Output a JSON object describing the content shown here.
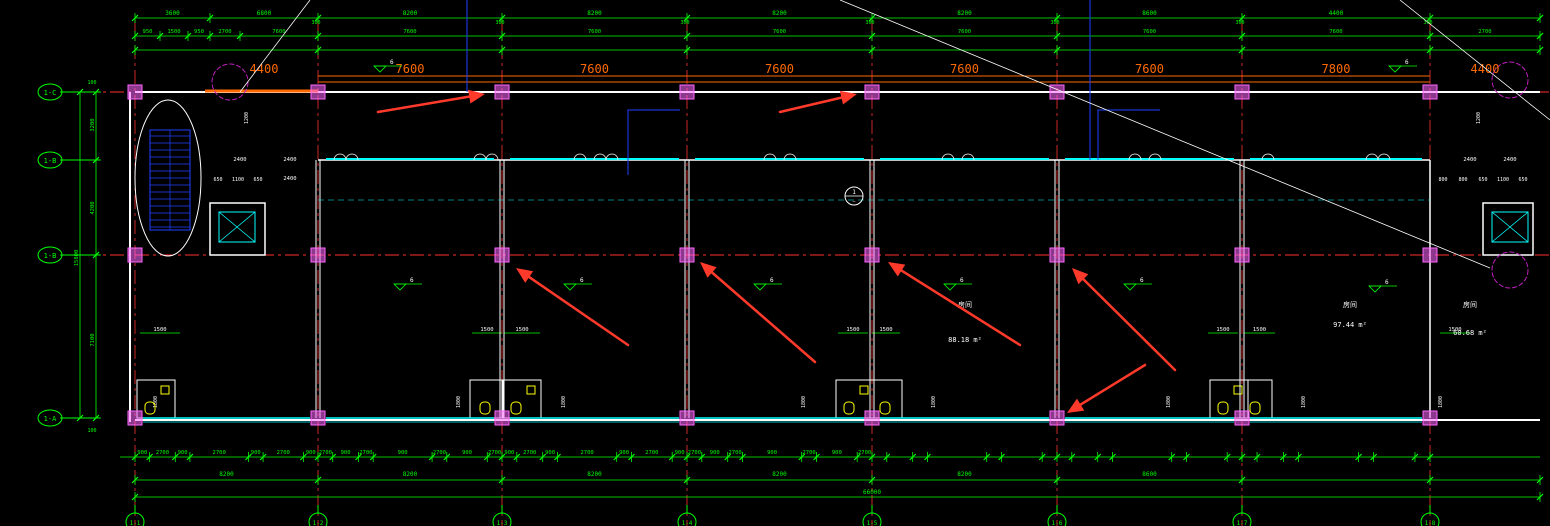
{
  "colors": {
    "background": "#000000",
    "dimension": "#00ff00",
    "wall": "#ffffff",
    "axis": "#ff3030",
    "column": "#ff66ff",
    "window": "#00ffff",
    "beam": "#ff6a00",
    "annotation": "#ffff00",
    "arrow": "#ff3a2a",
    "leader": "#2040ff"
  },
  "dims": {
    "top_bays": [
      "3600",
      "6800",
      "8200",
      "8200",
      "8200",
      "8200",
      "8600",
      "4400"
    ],
    "top_sub": [
      "950",
      "1500",
      "950",
      "2700",
      "7600",
      "7600",
      "7600",
      "7600",
      "7600",
      "7600",
      "7600",
      "2700"
    ],
    "beam_labels": [
      "4400",
      "7600",
      "7600",
      "7600",
      "7600",
      "7600",
      "7800",
      "4400"
    ],
    "bottom_bays": [
      "8200",
      "8200",
      "8200",
      "8200",
      "8200",
      "8600"
    ],
    "bottom_total": "66000",
    "bottom_sub": [
      "900",
      "2700",
      "900",
      "2700",
      "900",
      "2700",
      "900",
      "2700",
      "900",
      "2700",
      "900",
      "2700",
      "900",
      "2700",
      "900",
      "2700",
      "900",
      "2700",
      "900",
      "2700",
      "900",
      "2700",
      "900",
      "2700",
      "900",
      "2700",
      "900",
      "2700"
    ],
    "left_rows": [
      "3200",
      "4200",
      "15800",
      "7100"
    ],
    "left_small": [
      "100",
      "100"
    ],
    "corridor_dims": [
      "2400",
      "2400",
      "2400",
      "2400",
      "2400"
    ],
    "ramp_dims": [
      "650",
      "1100",
      "650",
      "800",
      "800",
      "650",
      "1100",
      "650"
    ],
    "door_widths": [
      "1500",
      "1500",
      "1500",
      "1500",
      "1500",
      "1500",
      "1500",
      "1500"
    ],
    "vertical_small": [
      "1800",
      "1800",
      "1800",
      "1800",
      "1800",
      "1800",
      "1800",
      "1800"
    ],
    "wall_offset": [
      "1200",
      "1200"
    ],
    "top_small": [
      "300",
      "300",
      "300",
      "300",
      "300",
      "300",
      "300"
    ]
  },
  "grid_labels": {
    "rows": [
      "1-C",
      "1-B",
      "1-B",
      "1-A"
    ],
    "cols": [
      "1-1",
      "1-2",
      "1-3",
      "1-4",
      "1-5",
      "1-6",
      "1-7",
      "1-8"
    ]
  },
  "rooms": [
    {
      "name": "房间",
      "area": "97.44 m²"
    },
    {
      "name": "房间",
      "area": "60.68 m²"
    },
    {
      "name": "房间",
      "area": "88.18 m²"
    }
  ],
  "elevation_mark": "6",
  "section_mark": {
    "number": "1",
    "sheet": "—"
  }
}
